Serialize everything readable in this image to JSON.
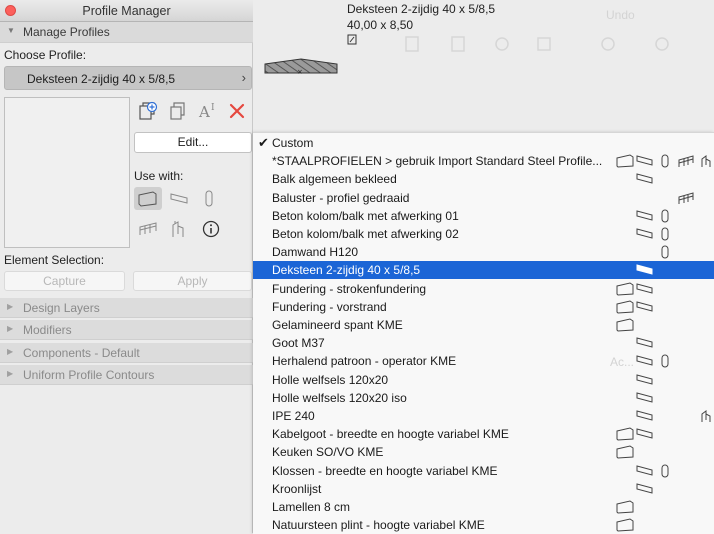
{
  "window": {
    "title": "Profile Manager"
  },
  "sections": {
    "manage_profiles": "Manage Profiles",
    "design_layers": "Design Layers",
    "modifiers": "Modifiers",
    "components": "Components - Default",
    "uniform_contours": "Uniform Profile Contours"
  },
  "labels": {
    "choose_profile": "Choose Profile:",
    "use_with": "Use with:",
    "element_selection": "Element Selection:"
  },
  "profile_select": {
    "value": "Deksteen 2-zijdig 40 x 5/8,5"
  },
  "buttons": {
    "edit": "Edit...",
    "capture": "Capture",
    "apply": "Apply"
  },
  "canvas": {
    "name": "Deksteen 2-zijdig 40 x 5/8,5",
    "size": "40,00 x 8,50",
    "ghost_undo": "Undo",
    "ghost_label": "Ac..."
  },
  "menu": {
    "items": [
      {
        "label": "Custom",
        "checked": true,
        "icons": []
      },
      {
        "label": "*STAALPROFIELEN > gebruik Import Standard Steel Profile...",
        "icons": [
          "wall",
          "beam",
          "column",
          "rail",
          "door"
        ]
      },
      {
        "label": "Balk algemeen bekleed",
        "icons": [
          "beam"
        ]
      },
      {
        "label": "Baluster - profiel gedraaid",
        "icons": [
          "rail"
        ]
      },
      {
        "label": "Beton kolom/balk met afwerking 01",
        "icons": [
          "beam",
          "column"
        ]
      },
      {
        "label": "Beton kolom/balk met afwerking 02",
        "icons": [
          "beam",
          "column"
        ]
      },
      {
        "label": "Damwand H120",
        "icons": [
          "column"
        ]
      },
      {
        "label": "Deksteen 2-zijdig 40 x 5/8,5",
        "selected": true,
        "icons": [
          "beam"
        ]
      },
      {
        "label": "Fundering - strokenfundering",
        "icons": [
          "wall",
          "beam"
        ]
      },
      {
        "label": "Fundering - vorstrand",
        "icons": [
          "wall",
          "beam"
        ]
      },
      {
        "label": "Gelamineerd spant KME",
        "icons": [
          "wall"
        ]
      },
      {
        "label": "Goot M37",
        "icons": [
          "beam"
        ]
      },
      {
        "label": "Herhalend patroon - operator KME",
        "icons": [
          "beam",
          "column"
        ]
      },
      {
        "label": "Holle welfsels 120x20",
        "icons": [
          "beam"
        ]
      },
      {
        "label": "Holle welfsels 120x20 iso",
        "icons": [
          "beam"
        ]
      },
      {
        "label": "IPE 240",
        "icons": [
          "beam",
          "door"
        ]
      },
      {
        "label": "Kabelgoot - breedte en hoogte variabel KME",
        "icons": [
          "wall",
          "beam"
        ]
      },
      {
        "label": "Keuken SO/VO KME",
        "icons": [
          "wall"
        ]
      },
      {
        "label": "Klossen - breedte en hoogte variabel KME",
        "icons": [
          "beam",
          "column"
        ]
      },
      {
        "label": "Kroonlijst",
        "icons": [
          "beam"
        ]
      },
      {
        "label": "Lamellen 8 cm",
        "icons": [
          "wall"
        ]
      },
      {
        "label": "Natuursteen plint - hoogte variabel KME",
        "icons": [
          "wall"
        ]
      }
    ]
  }
}
